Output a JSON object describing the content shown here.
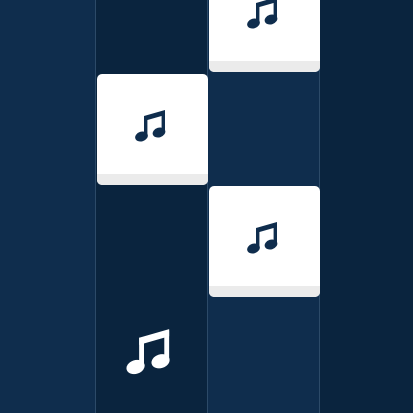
{
  "game": {
    "lane_count": 4,
    "colors": {
      "lane_light": "#0f2d4d",
      "lane_dark": "#0a243e",
      "divider": "#2c4a68",
      "tile_face": "#ffffff",
      "tile_edge": "#ebebeb",
      "note_on_tile": "#0f2d4d",
      "marker_note": "#ffffff"
    },
    "tiles": [
      {
        "lane": 3,
        "icon": "music-note-icon"
      },
      {
        "lane": 2,
        "icon": "music-note-icon"
      },
      {
        "lane": 3,
        "icon": "music-note-icon"
      }
    ],
    "hit_marker": {
      "lane": 2,
      "icon": "music-note-icon"
    }
  }
}
